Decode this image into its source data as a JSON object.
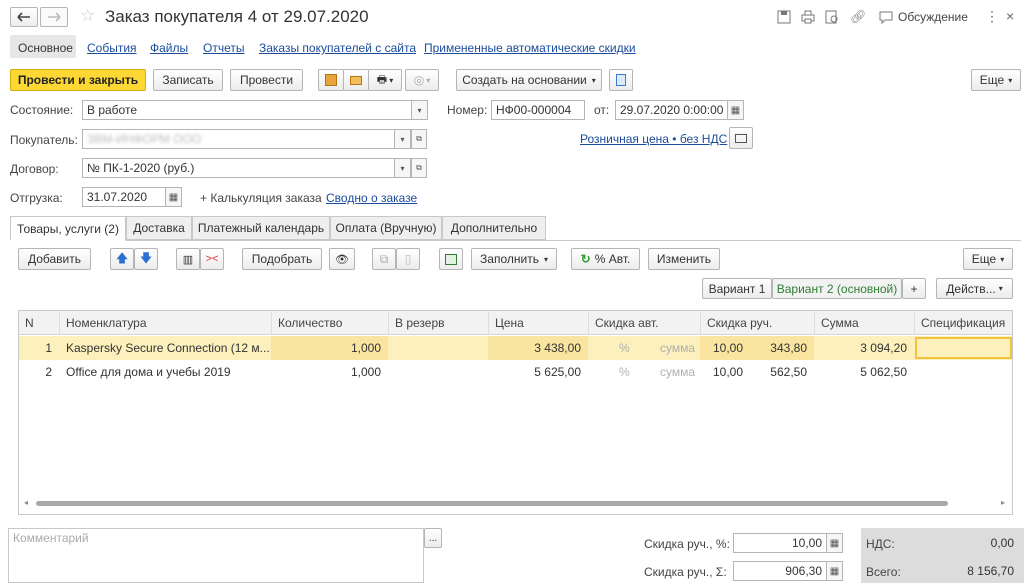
{
  "title": "Заказ покупателя 4 от 29.07.2020",
  "header": {
    "discussion": "Обсуждение"
  },
  "nav": [
    "Основное",
    "События",
    "Файлы",
    "Отчеты",
    "Заказы покупателей с сайта",
    "Примененные автоматические скидки"
  ],
  "toolbar": {
    "post_close": "Провести и закрыть",
    "save": "Записать",
    "post": "Провести",
    "create_based": "Создать на основании",
    "more": "Еще"
  },
  "form": {
    "state_label": "Состояние:",
    "state_value": "В работе",
    "number_label": "Номер:",
    "number_value": "НФ00-000004",
    "from_label": "от:",
    "date_value": "29.07.2020  0:00:00",
    "customer_label": "Покупатель:",
    "customer_value": "ЗВМ-ИНФОРМ ООО",
    "price_link": "Розничная цена • без НДС",
    "contract_label": "Договор:",
    "contract_value": "№ ПК-1-2020 (руб.)",
    "shipment_label": "Отгрузка:",
    "shipment_value": "31.07.2020",
    "calc_text": "+ Калькуляция заказа",
    "summary_link": "Сводно о заказе"
  },
  "tabs": [
    "Товары, услуги (2)",
    "Доставка",
    "Платежный календарь",
    "Оплата (Вручную)",
    "Дополнительно"
  ],
  "table_toolbar": {
    "add": "Добавить",
    "pick": "Подобрать",
    "fill": "Заполнить",
    "auto_pct": "% Авт.",
    "change": "Изменить",
    "more": "Еще"
  },
  "variants": {
    "v1": "Вариант 1",
    "v2": "Вариант 2 (основной)",
    "plus": "+",
    "actions": "Действ..."
  },
  "columns": [
    "N",
    "Номенклатура",
    "Количество",
    "В резерв",
    "Цена",
    "Скидка авт.",
    "Скидка руч.",
    "Сумма",
    "Спецификация"
  ],
  "rows": [
    {
      "n": "1",
      "name": "Kaspersky Secure Connection (12 м...",
      "qty": "1,000",
      "reserve": "",
      "price": "3 438,00",
      "auto_pct": "%",
      "auto_sum": "сумма",
      "man_pct": "10,00",
      "man_sum": "343,80",
      "sum": "3 094,20",
      "spec": ""
    },
    {
      "n": "2",
      "name": "Office для дома и учебы 2019",
      "qty": "1,000",
      "reserve": "",
      "price": "5 625,00",
      "auto_pct": "%",
      "auto_sum": "сумма",
      "man_pct": "10,00",
      "man_sum": "562,50",
      "sum": "5 062,50",
      "spec": ""
    }
  ],
  "footer": {
    "comment_placeholder": "Комментарий",
    "disc_pct_label": "Скидка руч., %:",
    "disc_pct_value": "10,00",
    "disc_sum_label": "Скидка руч., Σ:",
    "disc_sum_value": "906,30",
    "vat_label": "НДС:",
    "vat_value": "0,00",
    "total_label": "Всего:",
    "total_value": "8 156,70"
  },
  "colors": {
    "accent": "#fdd835",
    "link": "#1a4b9c",
    "selected_row": "#fcf0bd",
    "green_text": "#2e7d32"
  }
}
